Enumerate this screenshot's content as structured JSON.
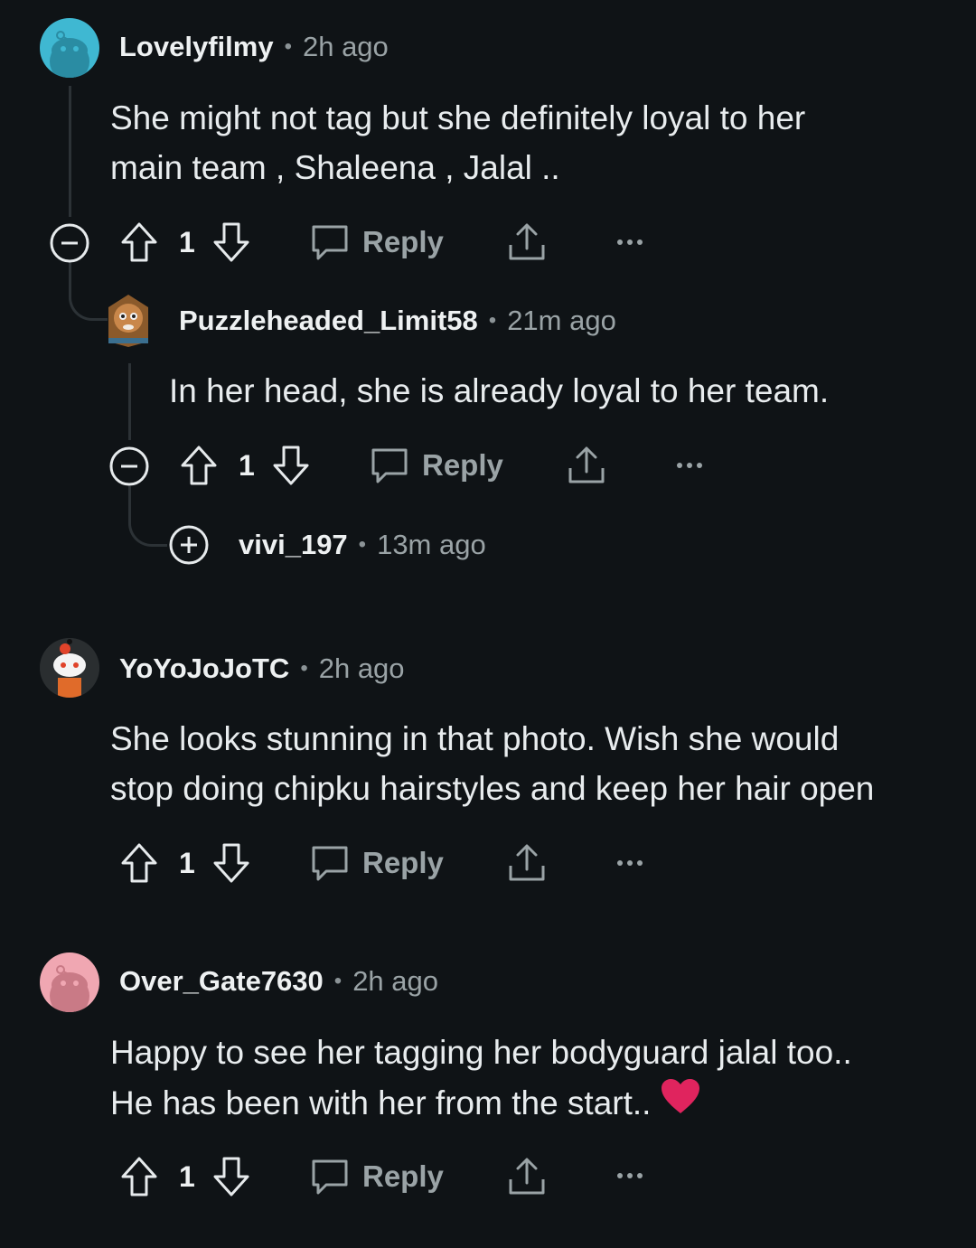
{
  "comments": [
    {
      "username": "Lovelyfilmy",
      "time": "2h ago",
      "body": [
        "She might not tag but she definitely loyal to her",
        "main team , Shaleena , Jalal .."
      ],
      "votes": "1",
      "reply_label": "Reply",
      "avatar_color": "#3fb8d2"
    },
    {
      "username": "Puzzleheaded_Limit58",
      "time": "21m ago",
      "body": [
        "In her head, she is already loyal to her team."
      ],
      "votes": "1",
      "reply_label": "Reply",
      "avatar_color": "#c9874a"
    },
    {
      "username": "vivi_197",
      "time": "13m ago"
    },
    {
      "username": "YoYoJoJoTC",
      "time": "2h ago",
      "body": [
        "She looks stunning in that photo. Wish she would",
        "stop doing chipku hairstyles and keep her hair open"
      ],
      "votes": "1",
      "reply_label": "Reply",
      "avatar_color": "#2a2e30"
    },
    {
      "username": "Over_Gate7630",
      "time": "2h ago",
      "body": [
        "Happy to see her tagging her bodyguard jalal too..",
        "He has been with her from the start.."
      ],
      "votes": "1",
      "reply_label": "Reply",
      "avatar_color": "#f0a7b2"
    }
  ],
  "icons": {
    "collapse": "collapse-minus-icon",
    "expand": "expand-plus-icon",
    "upvote": "upvote-arrow-icon",
    "downvote": "downvote-arrow-icon",
    "reply": "speech-bubble-icon",
    "share": "share-icon",
    "more": "more-dots-icon",
    "heart": "red-heart-emoji"
  },
  "colors": {
    "background": "#0f1316",
    "muted": "#9aa3a6",
    "text": "#e8ecee",
    "heart": "#e0245e"
  }
}
